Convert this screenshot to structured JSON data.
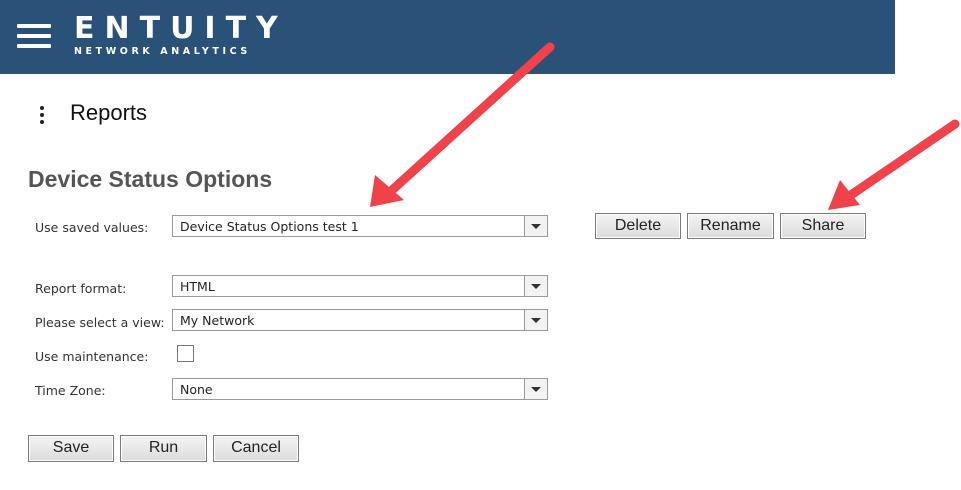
{
  "brand": {
    "name": "ENTUITY",
    "tagline": "NETWORK ANALYTICS"
  },
  "header": {
    "title": "Reports"
  },
  "form": {
    "title": "Device Status Options",
    "saved_values": {
      "label": "Use saved values:",
      "value": "Device Status Options test 1"
    },
    "report_format": {
      "label": "Report format:",
      "value": "HTML"
    },
    "view": {
      "label": "Please select a view:",
      "value": "My Network"
    },
    "maintenance": {
      "label": "Use maintenance:",
      "checked": false
    },
    "time_zone": {
      "label": "Time Zone:",
      "value": "None"
    }
  },
  "saved_actions": {
    "delete": "Delete",
    "rename": "Rename",
    "share": "Share"
  },
  "actions": {
    "save": "Save",
    "run": "Run",
    "cancel": "Cancel"
  },
  "annotations": {
    "arrow_color": "#f0424b"
  },
  "colors": {
    "header_bg": "#2a5177"
  }
}
